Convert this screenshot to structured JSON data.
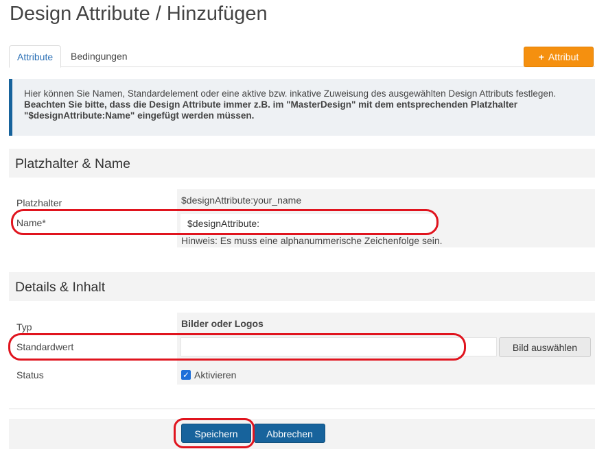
{
  "page": {
    "title": "Design Attribute / Hinzufügen"
  },
  "tabs": [
    {
      "label": "Attribute",
      "active": true
    },
    {
      "label": "Bedingungen",
      "active": false
    }
  ],
  "toolbar": {
    "add_label": "Attribut",
    "add_icon": "plus-icon",
    "add_color": "#f5900f"
  },
  "info": {
    "text": "Hier können Sie Namen, Standardelement oder eine aktive bzw. inkative Zuweisung des ausgewählten Design Attributs festlegen.",
    "bold_text": "Beachten Sie bitte, dass die Design Attribute immer z.B. im \"MasterDesign\" mit dem entsprechenden Platzhalter \"$designAttribute:Name\" eingefügt werden müssen."
  },
  "section_placeholder": {
    "title": "Platzhalter & Name",
    "placeholder_label": "Platzhalter",
    "placeholder_value": "$designAttribute:your_name",
    "name_label": "Name*",
    "name_prefix": "$designAttribute:",
    "name_hint": "Hinweis: Es muss eine alphanummerische Zeichenfolge sein."
  },
  "section_details": {
    "title": "Details & Inhalt",
    "type_label": "Typ",
    "type_value": "Bilder oder Logos",
    "default_label": "Standardwert",
    "default_value": "",
    "pick_image_label": "Bild auswählen",
    "status_label": "Status",
    "status_checkbox_label": "Aktivieren",
    "status_checked": true
  },
  "actions": {
    "save_label": "Speichern",
    "cancel_label": "Abbrechen",
    "primary_color": "#17639c"
  },
  "annotation_color": "#e0141e"
}
